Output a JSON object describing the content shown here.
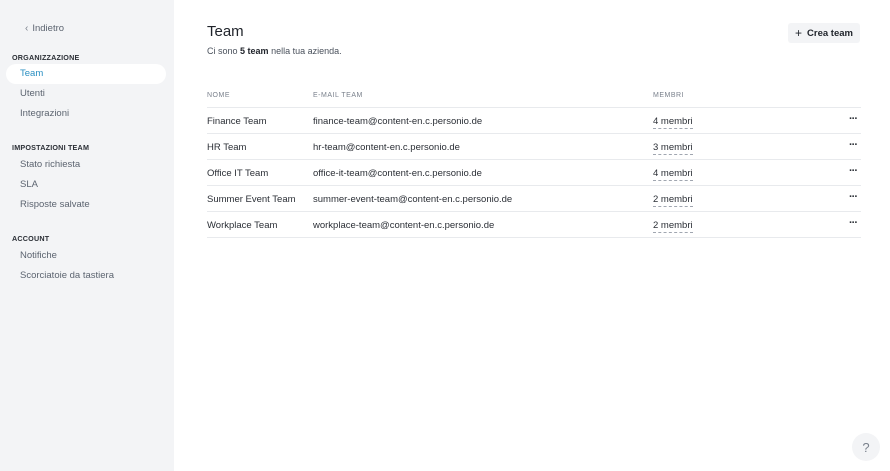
{
  "sidebar": {
    "back_label": "Indietro",
    "sections": [
      {
        "title": "ORGANIZZAZIONE",
        "items": [
          {
            "label": "Team"
          },
          {
            "label": "Utenti"
          },
          {
            "label": "Integrazioni"
          }
        ]
      },
      {
        "title": "IMPOSTAZIONI TEAM",
        "items": [
          {
            "label": "Stato richiesta"
          },
          {
            "label": "SLA"
          },
          {
            "label": "Risposte salvate"
          }
        ]
      },
      {
        "title": "ACCOUNT",
        "items": [
          {
            "label": "Notifiche"
          },
          {
            "label": "Scorciatoie da tastiera"
          }
        ]
      }
    ],
    "active_item": "Team"
  },
  "header": {
    "title": "Team",
    "subtitle_prefix": "Ci sono",
    "subtitle_count": "5 team",
    "subtitle_suffix": "nella tua azienda.",
    "create_button": "Crea team"
  },
  "table": {
    "columns": [
      "NOME",
      "E-MAIL TEAM",
      "MEMBRI"
    ],
    "rows": [
      {
        "name": "Finance Team",
        "email": "finance-team@content-en.c.personio.de",
        "members": "4 membri"
      },
      {
        "name": "HR Team",
        "email": "hr-team@content-en.c.personio.de",
        "members": "3 membri"
      },
      {
        "name": "Office IT Team",
        "email": "office-it-team@content-en.c.personio.de",
        "members": "4 membri"
      },
      {
        "name": "Summer Event Team",
        "email": "summer-event-team@content-en.c.personio.de",
        "members": "2 membri"
      },
      {
        "name": "Workplace Team",
        "email": "workplace-team@content-en.c.personio.de",
        "members": "2 membri"
      }
    ],
    "row_action": "···"
  },
  "help": {
    "label": "?"
  },
  "colors": {
    "accent": "#2a8fc2",
    "sidebar_bg": "#f3f4f6"
  }
}
